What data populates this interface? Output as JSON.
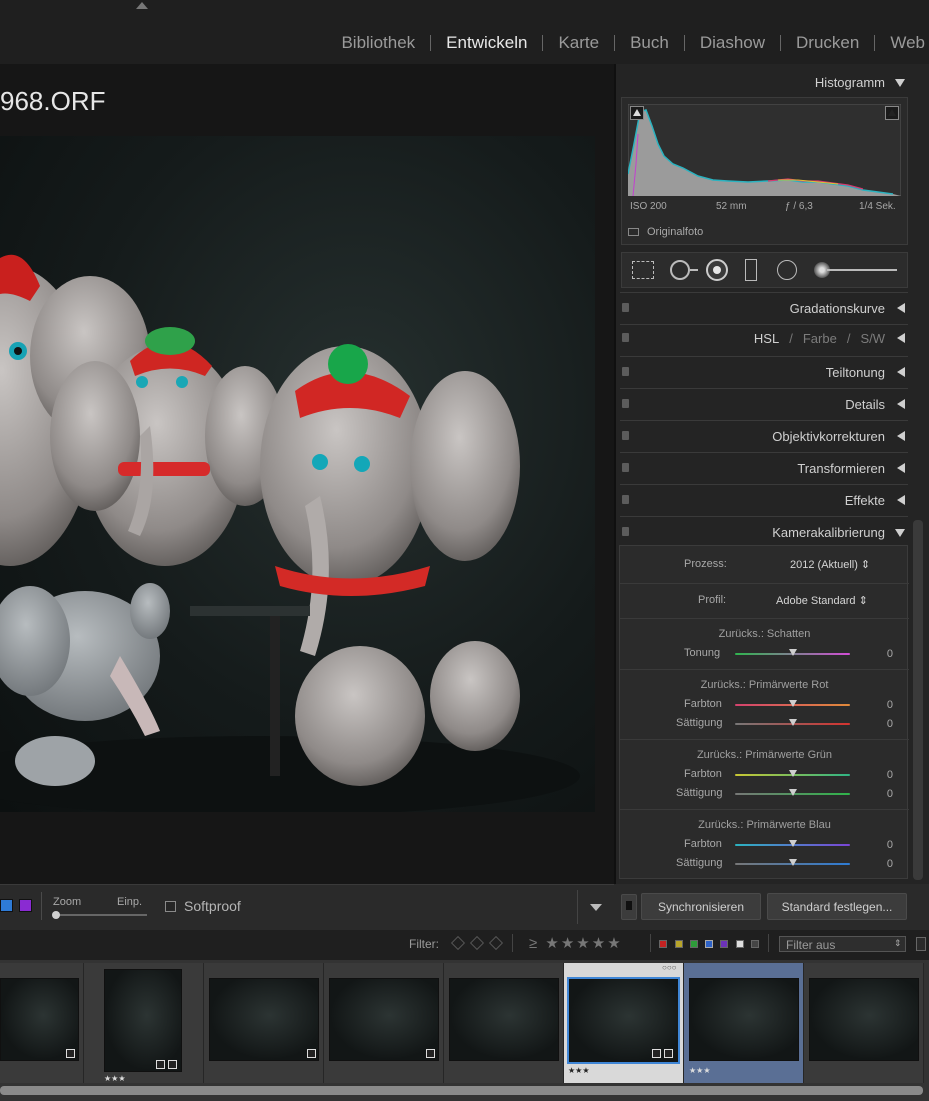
{
  "modules": {
    "items": [
      {
        "label": "Bibliothek",
        "active": false
      },
      {
        "label": "Entwickeln",
        "active": true
      },
      {
        "label": "Karte",
        "active": false
      },
      {
        "label": "Buch",
        "active": false
      },
      {
        "label": "Diashow",
        "active": false
      },
      {
        "label": "Drucken",
        "active": false
      },
      {
        "label": "Web",
        "active": false
      }
    ]
  },
  "viewer": {
    "filename": "968.ORF"
  },
  "histogram": {
    "title": "Histogramm",
    "iso": "ISO 200",
    "focal": "52 mm",
    "aperture": "ƒ / 6,3",
    "shutter": "1/4 Sek.",
    "original_label": "Originalfoto"
  },
  "panels": {
    "tone_curve": "Gradationskurve",
    "hsl": "HSL",
    "farbe": "Farbe",
    "sw": "S/W",
    "split_toning": "Teiltonung",
    "details": "Details",
    "lens": "Objektivkorrekturen",
    "transform": "Transformieren",
    "effects": "Effekte",
    "calibration": "Kamerakalibrierung"
  },
  "calibration": {
    "process_label": "Prozess:",
    "process_value": "2012 (Aktuell) ⇕",
    "profile_label": "Profil:",
    "profile_value": "Adobe Standard ⇕",
    "shadows": {
      "title": "Zurücks.: Schatten",
      "tint_label": "Tonung",
      "tint_value": "0"
    },
    "red": {
      "title": "Zurücks.: Primärwerte Rot",
      "hue_label": "Farbton",
      "hue_value": "0",
      "sat_label": "Sättigung",
      "sat_value": "0"
    },
    "green": {
      "title": "Zurücks.: Primärwerte Grün",
      "hue_label": "Farbton",
      "hue_value": "0",
      "sat_label": "Sättigung",
      "sat_value": "0"
    },
    "blue": {
      "title": "Zurücks.: Primärwerte Blau",
      "hue_label": "Farbton",
      "hue_value": "0",
      "sat_label": "Sättigung",
      "sat_value": "0"
    }
  },
  "bottom": {
    "sync_label": "Synchronisieren",
    "default_label": "Standard festlegen...",
    "zoom_label": "Zoom",
    "fit_label": "Einp.",
    "softproof_label": "Softproof"
  },
  "filter": {
    "label": "Filter:",
    "stars": "≥ ★★★★★",
    "dropdown": "Filter aus"
  },
  "filmstrip": {
    "rating_1": "★★★",
    "rating_5": "★★★",
    "rating_6": "★★★",
    "dots": "○○○"
  },
  "colors": {
    "accent_selected": "#5a6f95",
    "panel_bg": "#242424"
  }
}
